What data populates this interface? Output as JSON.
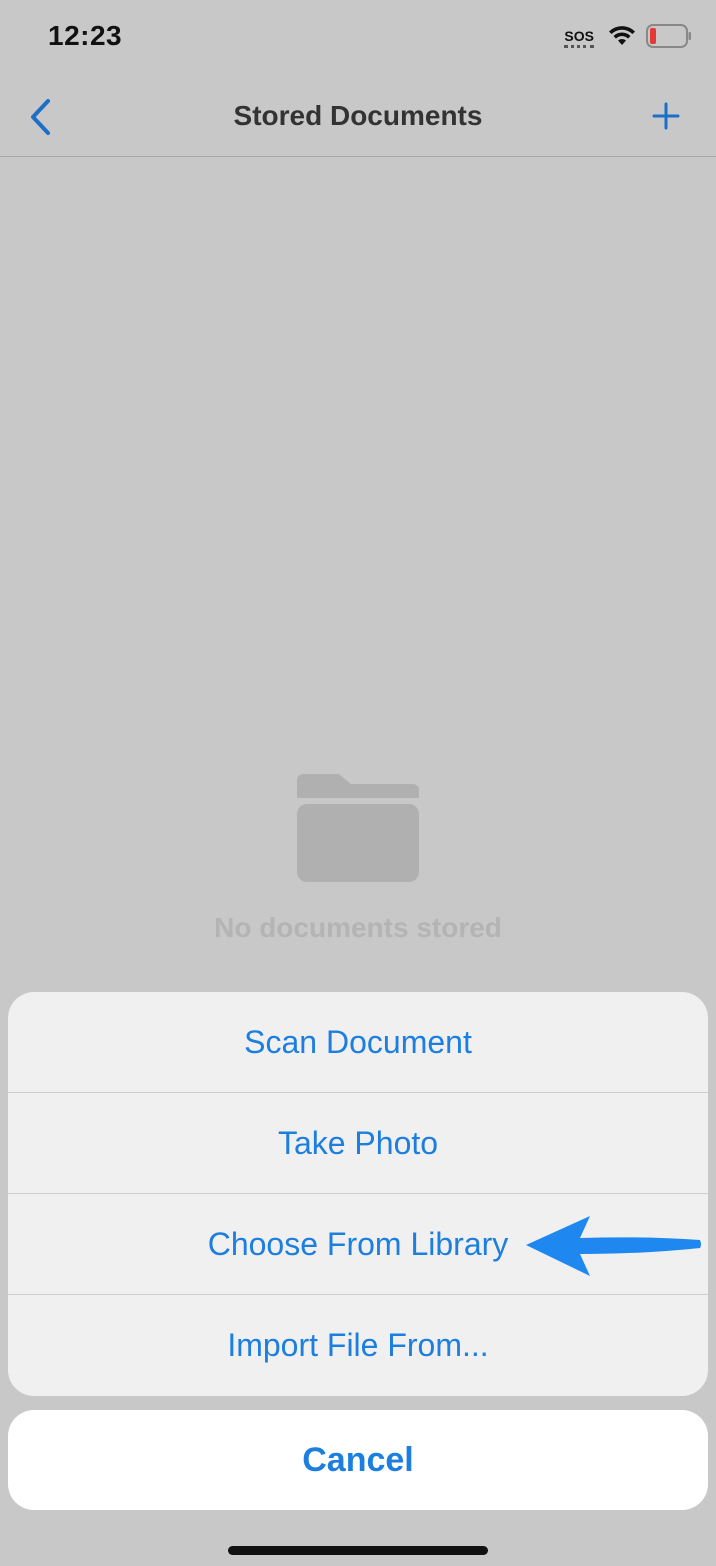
{
  "status_bar": {
    "time": "12:23",
    "sos": "SOS",
    "icons": [
      "wifi-icon",
      "battery-low-icon"
    ],
    "battery_color": "#e53935"
  },
  "nav": {
    "back_icon": "chevron-left-icon",
    "title": "Stored Documents",
    "add_icon": "plus-icon"
  },
  "empty_state": {
    "icon": "folder-icon",
    "text": "No documents stored"
  },
  "action_sheet": {
    "items": [
      {
        "label": "Scan Document"
      },
      {
        "label": "Take Photo"
      },
      {
        "label": "Choose From Library"
      },
      {
        "label": "Import File From..."
      }
    ],
    "cancel_label": "Cancel"
  },
  "annotation": {
    "icon": "arrow-left-icon",
    "points_to": "Choose From Library",
    "color": "#1e88f0"
  },
  "colors": {
    "accent": "#1c7fe0",
    "background_dimmed": "#c8c8c8"
  }
}
